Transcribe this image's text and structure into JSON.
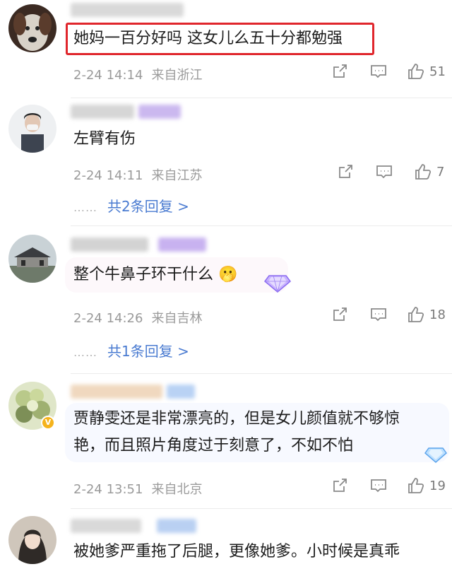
{
  "comments": [
    {
      "text": "她妈一百分好吗 这女儿么五十分都勉强",
      "date": "2-24 14:14",
      "location": "来自浙江",
      "likes": "51"
    },
    {
      "text": "左臂有伤",
      "date": "2-24 14:11",
      "location": "来自江苏",
      "likes": "7",
      "replies_label": "共2条回复 >"
    },
    {
      "text": "整个牛鼻子环干什么",
      "emoji": "🫢",
      "date": "2-24 14:26",
      "location": "来自吉林",
      "likes": "18",
      "replies_label": "共1条回复 >"
    },
    {
      "text_lines": [
        "贾静雯还是非常漂亮的，但是女儿颜值就不够惊",
        "艳，而且照片角度过于刻意了，不如不怕"
      ],
      "badge": "V",
      "date": "2-24 13:51",
      "location": "来自北京",
      "likes": "19"
    },
    {
      "text": "被她爹严重拖了后腿，更像她爹。小时候是真乖"
    }
  ],
  "reply_dots": "……",
  "icons": [
    "share-icon",
    "comment-icon",
    "like-thumb-icon",
    "diamond-badge-icon"
  ],
  "colors": {
    "reply_link": "#4a7bd1",
    "highlight_border": "#e0262c",
    "meta_text": "#9a9a9a"
  }
}
